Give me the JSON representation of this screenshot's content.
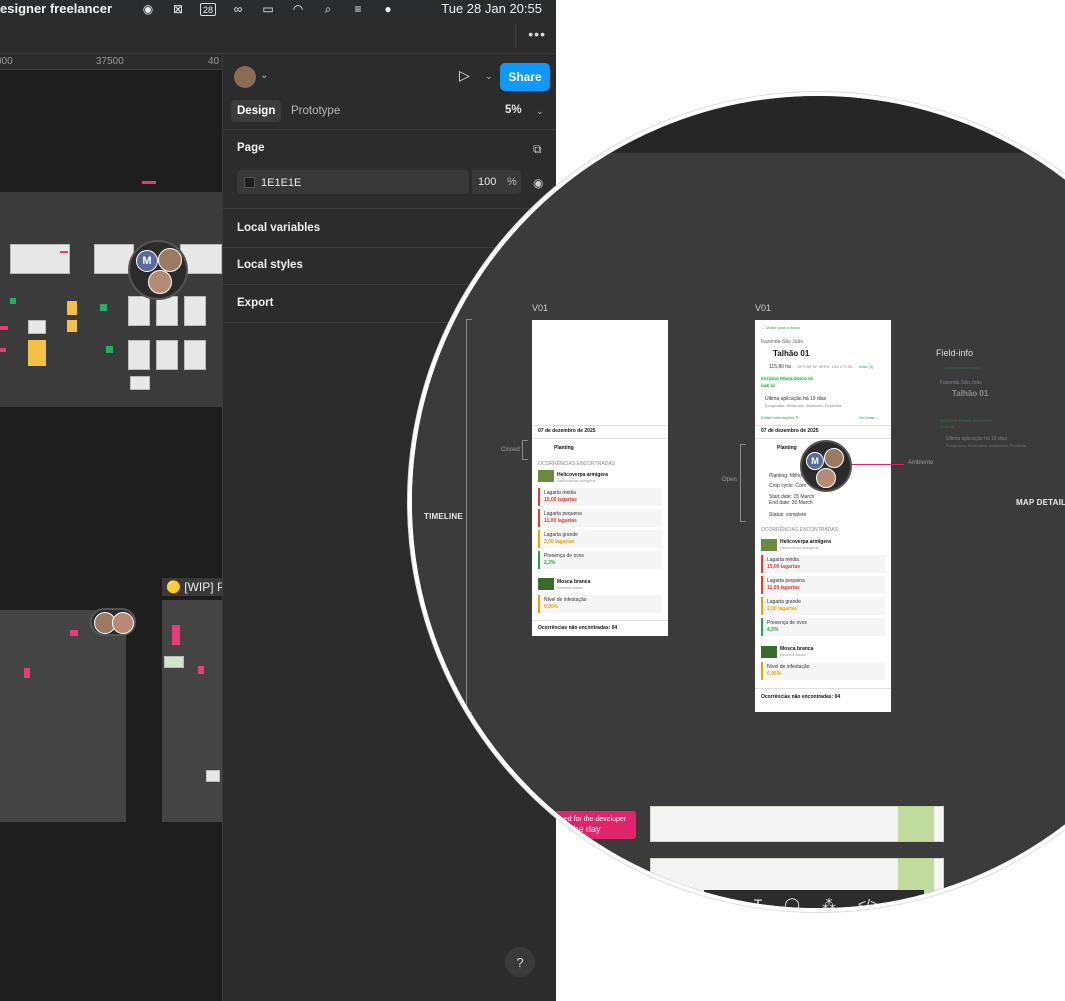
{
  "menubar": {
    "app_title": "esigner freelancer",
    "clock": "Tue 28 Jan  20:55",
    "icons": [
      "grammarly-icon",
      "screen-record-icon",
      "calendar-icon",
      "glasses-icon",
      "battery-icon",
      "wifi-icon",
      "spotlight-search-icon",
      "control-center-icon",
      "siri-icon"
    ],
    "calendar_day": "28"
  },
  "ruler": {
    "ticks": [
      "000",
      "37500",
      "40"
    ]
  },
  "toolbar": {
    "more_label": "•••"
  },
  "panel": {
    "tabs": [
      {
        "label": "Design",
        "active": true
      },
      {
        "label": "Prototype",
        "active": false
      }
    ],
    "zoom": "5%",
    "share_label": "Share",
    "page": {
      "title": "Page",
      "color_hex": "1E1E1E",
      "opacity": "100",
      "opacity_unit": "%"
    },
    "sections": [
      "Local variables",
      "Local styles",
      "Export"
    ],
    "help_label": "?"
  },
  "canvas": {
    "wip_label": "🟡 [WIP] P",
    "avatar_initial": "M"
  },
  "zoomed": {
    "version_left": "V01",
    "version_right": "V01",
    "timeline_label": "TIMELINE",
    "map_detail_label": "MAP DETAIL",
    "field_info_label": "Field-info",
    "closed_label": "Closed",
    "open_label": "Open",
    "ambience_label": "Ambiente",
    "left_phone": {
      "date": "07 de dezembro de 2025",
      "stage": "Planting",
      "occurrences_header": "OCORRÊNCIAS ENCONTRADAS",
      "pest1": "Helicoverpa armigera",
      "pest1_sub": "Helicoverpa armigera",
      "m1_label": "Lagarta média",
      "m1_value": "15,00 lagartas",
      "m2_label": "Lagarta pequena",
      "m2_value": "11,00 lagartas",
      "m3_label": "Lagarta grande",
      "m3_value": "2,00 lagartas",
      "m4_label": "Presença de ovos",
      "m4_value": "2,3%",
      "pest2": "Mosca branca",
      "pest2_sub": "Bemisia tabaci",
      "m5_label": "Nível de infestação",
      "m5_value": "0,95%",
      "not_found": "Ocorrências não encontradas: 04"
    },
    "right_phone": {
      "back": "← Voltar para o mapa",
      "farm": "Fazenda São João",
      "field": "Talhão 01",
      "area": "115,80 ha",
      "coords": "15°S 55°W, 3RRS, 15S 17S 55",
      "more": "mais (3)",
      "tag1": "ESTÁDIO FENOLÓGICO V5",
      "tag2": "DAE 32",
      "last_app": "Última aplicação há 19 dias",
      "products": "Fungicidas, Herbicida, Inseticida, Pesticida",
      "edit": "Editar informações ✎",
      "see_more": "Ver mais ⌄",
      "date": "07 de dezembro de 2025",
      "stage": "Planting",
      "crop": "Planting: Milho",
      "cycle": "Crop cycle: Corn",
      "start": "Start date: 15 March",
      "end": "End date: 30 March",
      "status": "Status: complete",
      "occurrences_header": "OCORRÊNCIAS ENCONTRADAS",
      "pest1": "Helicoverpa armigera",
      "pest1_sub": "Helicoverpa armigera",
      "m1_label": "Lagarta média",
      "m1_value": "15,00 lagartas",
      "m2_label": "Lagarta pequena",
      "m2_value": "11,00 lagartas",
      "m3_label": "Lagarta grande",
      "m3_value": "2,00 lagartas",
      "m4_label": "Presença de ovos",
      "m4_value": "4,3%",
      "pest2": "Mosca branca",
      "pest2_sub": "Bemisia tabaci",
      "m5_label": "Nível de infestação",
      "m5_value": "0,95%",
      "not_found": "Ocorrências não encontradas: 04"
    },
    "field_info": {
      "back": "← Voltar para o mapa",
      "farm": "Fazenda São João",
      "field": "Talhão 01",
      "tag1": "ESTÁDIO FENOLÓGICO V5",
      "tag2": "DAE 32",
      "last_app": "Última aplicação há 19 dias",
      "products": "Fungicidas, Herbicidas, Inseticidas, Pesticida"
    },
    "dev_badge_line1": "...ed for the developer",
    "dev_badge_line2": "for the day"
  },
  "colors": {
    "accent": "#0d99ff",
    "canvas": "#1e1e1e",
    "panel": "#2c2c2c",
    "danger": "#e53935",
    "warning": "#e0a800",
    "success": "#2e9e4f",
    "pink": "#e0246b"
  }
}
